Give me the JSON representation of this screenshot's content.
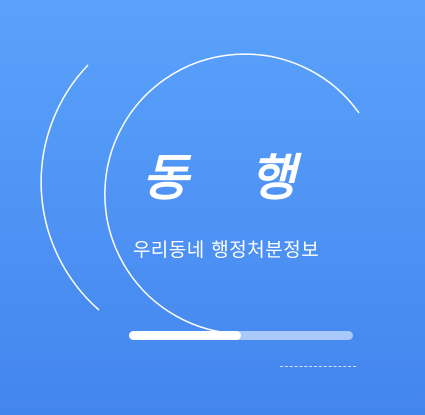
{
  "splash": {
    "title": "동 행",
    "subtitle": "우리동네 행정처분정보",
    "progress": 0.5,
    "colors": {
      "background_top": "#5aa2fb",
      "background_bottom": "#4385ee",
      "progress_fill": "#ffffff",
      "progress_track": "#a9c9fb"
    }
  }
}
